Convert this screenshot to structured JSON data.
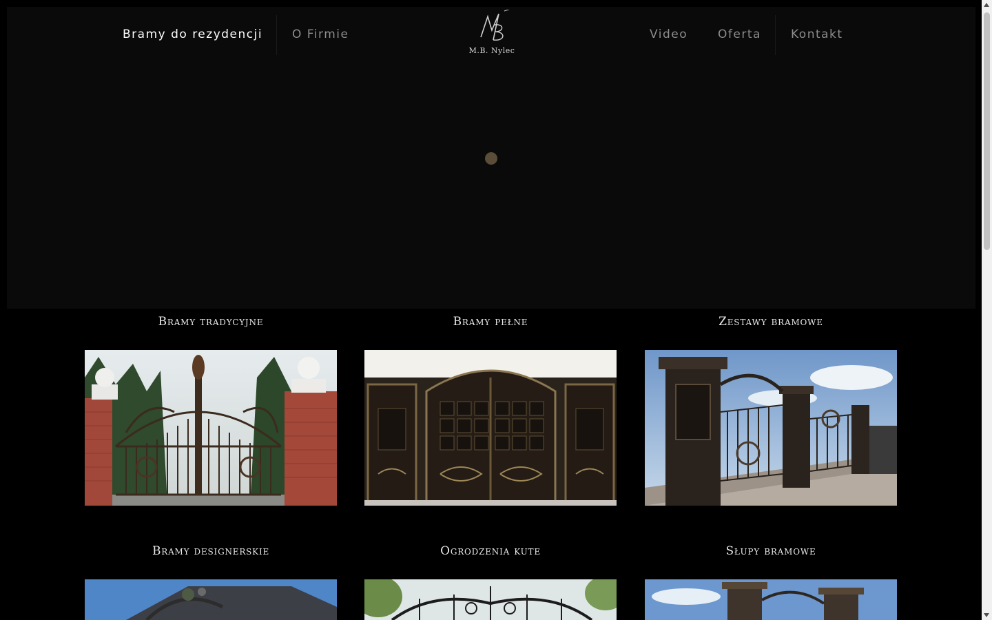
{
  "nav": {
    "left": [
      "Bramy do rezydencji",
      "O Firmie"
    ],
    "right": [
      "Video",
      "Oferta",
      "Kontakt"
    ]
  },
  "logo": {
    "monogram": "MB",
    "text": "M.B. Nylec"
  },
  "categories": [
    "Bramy tradycyjne",
    "Bramy pełne",
    "Zestawy bramowe",
    "Bramy designerskie",
    "Ogrodzenia kute",
    "Słupy bramowe"
  ],
  "colors": {
    "background": "#000000",
    "hero": "#0a0a0b",
    "loader": "#5c4d38"
  }
}
